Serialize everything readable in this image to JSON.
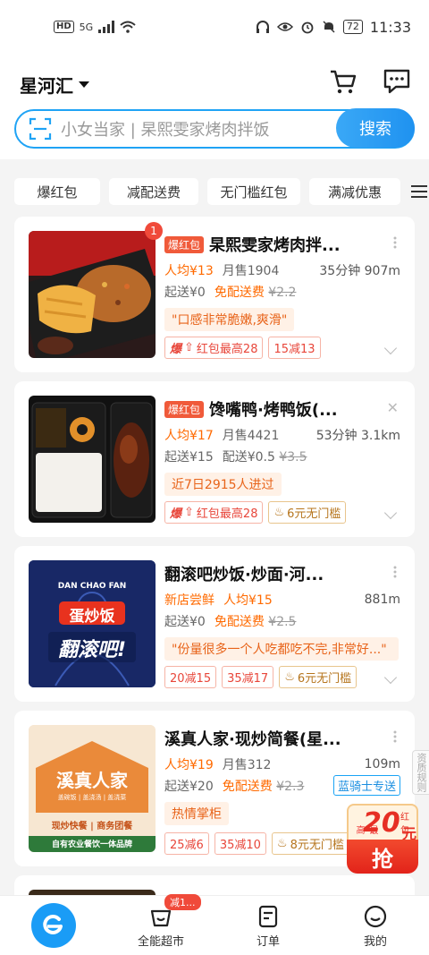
{
  "status_bar": {
    "network": "HD",
    "signal": "5G",
    "battery": "72",
    "time": "11:33"
  },
  "header": {
    "city": "星河汇",
    "search_placeholder": "小女当家 | 杲熙雯家烤肉拌饭",
    "search_button": "搜索"
  },
  "filters": [
    "爆红包",
    "减配送费",
    "无门槛红包",
    "满减优惠"
  ],
  "stores": [
    {
      "badge_count": "1",
      "tag": "爆红包",
      "name": "杲熙雯家烤肉拌...",
      "per_capita": "人均¥13",
      "monthly_sales": "月售1904",
      "time_distance": "35分钟 907m",
      "min_order": "起送¥0",
      "delivery": "免配送费",
      "delivery_old": "¥2.2",
      "highlight": "\"口感非常脆嫩,爽滑\"",
      "coupons": [
        "爆",
        "红包最高28",
        "15减13"
      ]
    },
    {
      "tag": "爆红包",
      "name": "馋嘴鸭·烤鸭饭(...",
      "per_capita": "人均¥17",
      "monthly_sales": "月售4421",
      "time_distance": "53分钟 3.1km",
      "min_order": "起送¥15",
      "delivery": "配送¥0.5",
      "delivery_old": "¥3.5",
      "highlight": "近7日2915人进过",
      "coupons": [
        "爆",
        "红包最高28",
        "6元无门槛"
      ]
    },
    {
      "name": "翻滚吧炒饭·炒面·河...",
      "new_tag": "新店尝鲜",
      "per_capita": "人均¥15",
      "time_distance": "881m",
      "min_order": "起送¥0",
      "delivery": "免配送费",
      "delivery_old": "¥2.5",
      "highlight": "\"份量很多一个人吃都吃不完,非常好...\"",
      "coupons": [
        "20减15",
        "35减17",
        "6元无门槛"
      ],
      "thumb_text": {
        "top": "DAN CHAO FAN",
        "mid": "蛋炒饭",
        "bot": "翻滚吧!"
      }
    },
    {
      "name": "溪真人家·现炒简餐(星...",
      "per_capita": "人均¥19",
      "monthly_sales": "月售312",
      "time_distance": "109m",
      "min_order": "起送¥20",
      "delivery": "免配送费",
      "delivery_old": "¥2.3",
      "rider": "蓝骑士专送",
      "highlight": "热情掌柜",
      "coupons": [
        "25减6",
        "35减10",
        "8元无门槛"
      ],
      "thumb_text": {
        "brand": "溪真人家",
        "sub": "盖碗饭 | 盖浇汤 | 盖浇菜",
        "line": "现炒快餐 | 商务团餐",
        "foot": "自有农业餐饮一体品牌"
      }
    }
  ],
  "float_packet": {
    "small_label": "最高",
    "amount": "20",
    "unit": "元",
    "tag": "红包",
    "button": "抢"
  },
  "side_tip": "资质规则",
  "bottom_nav": [
    {
      "label": ""
    },
    {
      "label": "全能超市",
      "badge": "减1..."
    },
    {
      "label": "订单"
    },
    {
      "label": "我的"
    }
  ],
  "colors": {
    "accent": "#1fa3f5",
    "hot": "#f05a3a",
    "orange": "#ff6a00"
  }
}
